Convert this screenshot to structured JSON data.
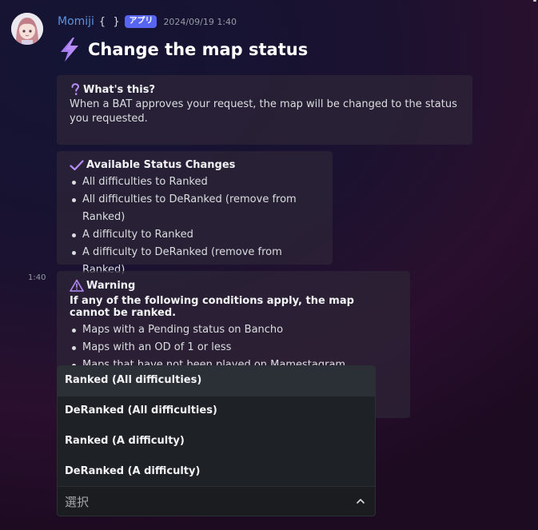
{
  "message": {
    "username": "Momiji",
    "bot_braces": "{ }",
    "app_tag": "アプリ",
    "timestamp": "2024/09/19 1:40",
    "side_time": "1:40",
    "title": "Change the map status"
  },
  "cards": {
    "whats_this": {
      "heading": "What's this?",
      "body": "When a BAT approves your request, the map will be changed to the status you requested."
    },
    "available": {
      "heading": "Available Status Changes",
      "items": [
        "All difficulties to Ranked",
        "All difficulties to DeRanked (remove from Ranked)",
        "A difficulty to Ranked",
        "A difficulty to DeRanked (remove from Ranked)"
      ]
    },
    "warning": {
      "heading": "Warning",
      "bold_line": "If any of the following conditions apply, the map cannot be ranked.",
      "items": [
        "Maps with a Pending status on Bancho",
        "Maps with an OD of 1 or less",
        "Maps that have not been played on Mamestagram"
      ]
    }
  },
  "dropdown": {
    "options": [
      "Ranked (All difficulties)",
      "DeRanked (All difficulties)",
      "Ranked (A difficulty)",
      "DeRanked (A difficulty)"
    ],
    "highlighted_index": 0,
    "placeholder": "選択"
  },
  "icons": {
    "title_icon": "lightning-bolt-icon",
    "whats_this_icon": "question-mark-icon",
    "available_icon": "check-mark-icon",
    "warning_icon": "warning-triangle-icon",
    "select_icon": "chevron-up-icon"
  },
  "colors": {
    "username": "#5b93df",
    "app_tag": "#5865f2",
    "accent_purple": "#a78bfa",
    "card_bg": "#2e2638"
  }
}
